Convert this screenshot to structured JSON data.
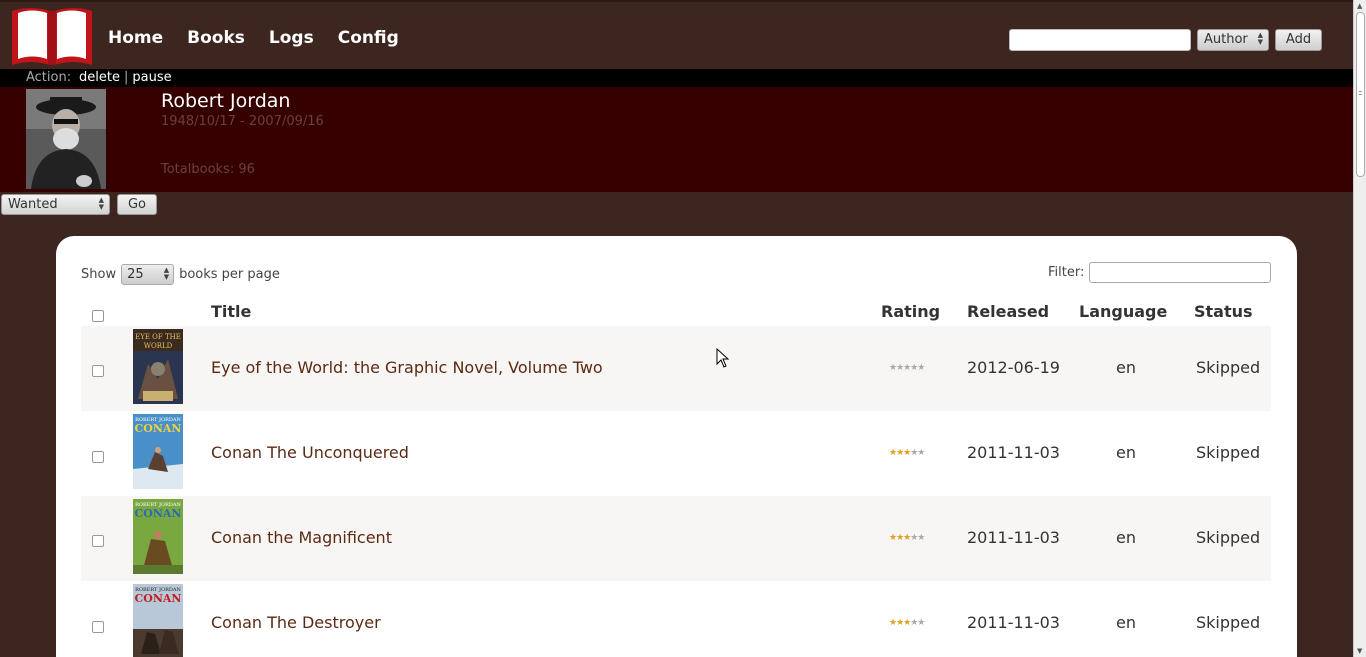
{
  "header": {
    "nav": [
      "Home",
      "Books",
      "Logs",
      "Config"
    ],
    "search": {
      "value": "",
      "placeholder": ""
    },
    "search_type": "Author",
    "add_label": "Add"
  },
  "actionbar": {
    "label": "Action:",
    "delete": "delete",
    "separator": "|",
    "pause": "pause"
  },
  "author": {
    "name": "Robert Jordan",
    "dates": "1948/10/17 - 2007/09/16",
    "total": "Totalbooks: 96"
  },
  "status_control": {
    "selected": "Wanted",
    "go_label": "Go"
  },
  "table": {
    "show_label": "Show",
    "per_page": "25",
    "per_page_suffix": "books per page",
    "filter_label": "Filter:",
    "columns": [
      "Title",
      "Rating",
      "Released",
      "Language",
      "Status"
    ],
    "rows": [
      {
        "title": "Eye of the World: the Graphic Novel, Volume Two",
        "rating": 0,
        "released": "2012-06-19",
        "language": "en",
        "status": "Skipped"
      },
      {
        "title": "Conan The Unconquered",
        "rating": 3,
        "released": "2011-11-03",
        "language": "en",
        "status": "Skipped"
      },
      {
        "title": "Conan the Magnificent",
        "rating": 3,
        "released": "2011-11-03",
        "language": "en",
        "status": "Skipped"
      },
      {
        "title": "Conan The Destroyer",
        "rating": 3,
        "released": "2011-11-03",
        "language": "en",
        "status": "Skipped"
      }
    ]
  },
  "colors": {
    "background": "#3d2620",
    "author_panel": "#370000",
    "logo_red": "#c0141a",
    "link_brown": "#5a2a14",
    "star_on": "#e0a020"
  }
}
